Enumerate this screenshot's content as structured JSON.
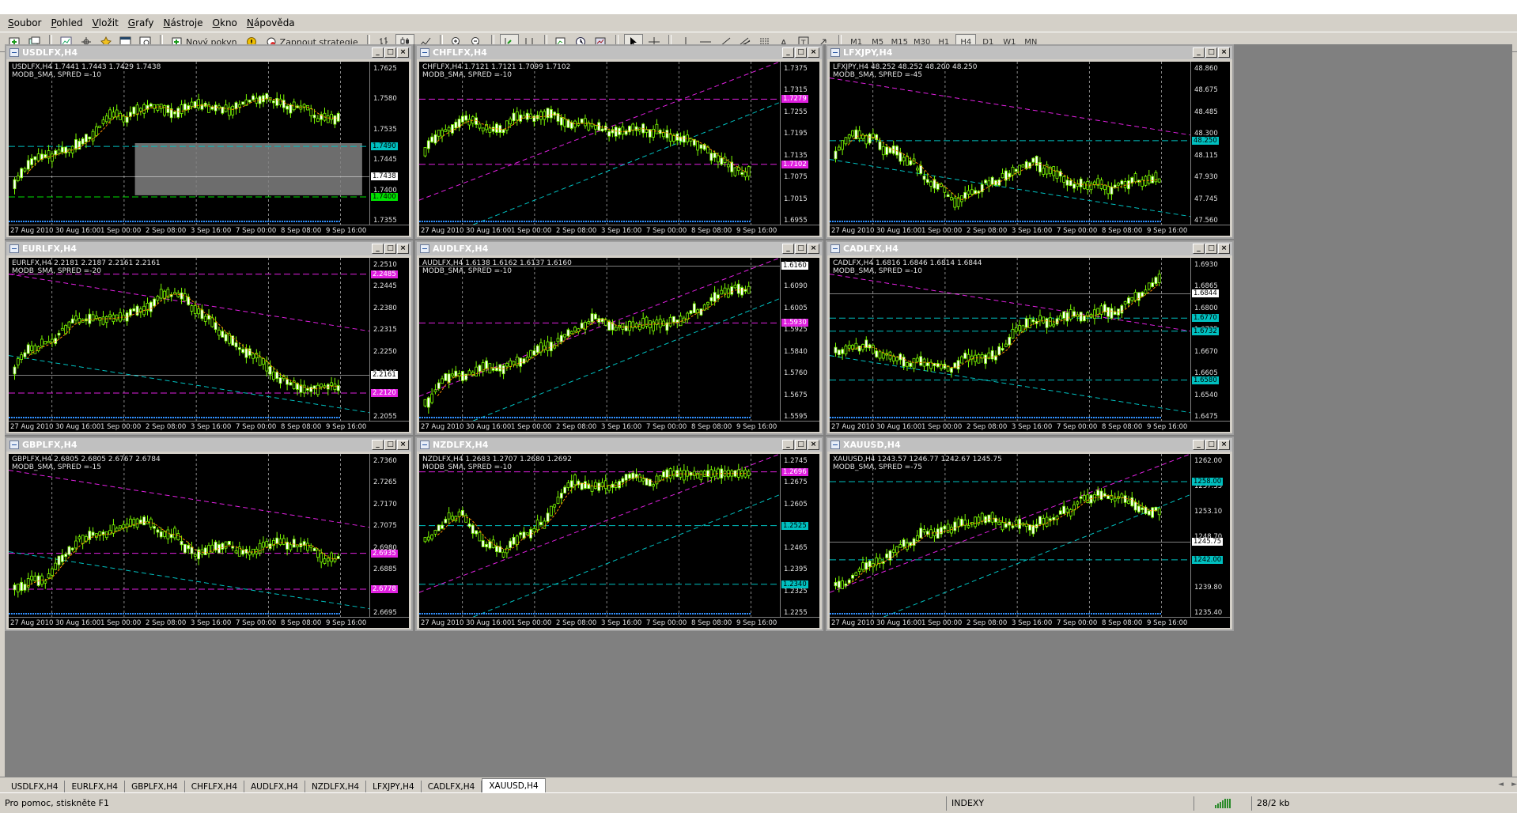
{
  "menu": [
    "Soubor",
    "Pohled",
    "Vložit",
    "Grafy",
    "Nástroje",
    "Okno",
    "Nápověda"
  ],
  "toolbar": {
    "new_order": "Nový pokyn",
    "autotrading": "Zapnout strategie",
    "timeframes": [
      "M1",
      "M5",
      "M15",
      "M30",
      "H1",
      "H4",
      "D1",
      "W1",
      "MN"
    ],
    "active_timeframe": "H4"
  },
  "time_labels": [
    "27 Aug 2010",
    "30 Aug 16:00",
    "1 Sep 00:00",
    "2 Sep 08:00",
    "3 Sep 16:00",
    "7 Sep 00:00",
    "8 Sep 08:00",
    "9 Sep 16:00"
  ],
  "charts": [
    {
      "title": "USDLFX,H4",
      "info1": "USDLFX,H4  1.7441 1.7443 1.7429 1.7438",
      "info2": "MODB_SMA, SPRED =-10",
      "ticks": [
        "1.7625",
        "1.7580",
        "1.7535",
        "1.7445",
        "1.7400",
        "1.7355"
      ],
      "markers": [
        {
          "label": "1.7490",
          "color": "#00c0c0",
          "y": 0.52
        },
        {
          "label": "1.7438",
          "color": "#ffffff",
          "y": 0.705
        },
        {
          "label": "1.7400",
          "color": "#00e000",
          "y": 0.83
        }
      ]
    },
    {
      "title": "CHFLFX,H4",
      "info1": "CHFLFX,H4  1.7121 1.7121 1.7099 1.7102",
      "info2": "MODB_SMA, SPRED =-10",
      "ticks": [
        "1.7375",
        "1.7315",
        "1.7255",
        "1.7195",
        "1.7135",
        "1.7075",
        "1.7015",
        "1.6955"
      ],
      "markers": [
        {
          "label": "1.7279",
          "color": "#e020e0",
          "y": 0.23
        },
        {
          "label": "1.7102",
          "color": "#e020e0",
          "y": 0.63
        }
      ]
    },
    {
      "title": "LFXJPY,H4",
      "info1": "LFXJPY,H4  48.252 48.252 48.200 48.250",
      "info2": "MODB_SMA, SPRED =-45",
      "ticks": [
        "48.860",
        "48.675",
        "48.485",
        "48.300",
        "48.115",
        "47.930",
        "47.745",
        "47.560"
      ],
      "markers": [
        {
          "label": "48.250",
          "color": "#00c0c0",
          "y": 0.485
        }
      ]
    },
    {
      "title": "EURLFX,H4",
      "info1": "EURLFX,H4  2.2181 2.2187 2.2161 2.2161",
      "info2": "MODB_SMA, SPRED =-20",
      "ticks": [
        "2.2510",
        "2.2445",
        "2.2380",
        "2.2315",
        "2.2250",
        "2.2185",
        "2.2120",
        "2.2055"
      ],
      "markers": [
        {
          "label": "2.2485",
          "color": "#e020e0",
          "y": 0.1
        },
        {
          "label": "2.2161",
          "color": "#ffffff",
          "y": 0.72
        },
        {
          "label": "2.2120",
          "color": "#e020e0",
          "y": 0.83
        }
      ]
    },
    {
      "title": "AUDLFX,H4",
      "info1": "AUDLFX,H4  1.6138 1.6162 1.6137 1.6160",
      "info2": "MODB_SMA, SPRED =-10",
      "ticks": [
        "1.6160",
        "1.6090",
        "1.6005",
        "1.5925",
        "1.5840",
        "1.5760",
        "1.5675",
        "1.5595"
      ],
      "markers": [
        {
          "label": "1.6160",
          "color": "#ffffff",
          "y": 0.05
        },
        {
          "label": "1.5930",
          "color": "#e020e0",
          "y": 0.4
        }
      ]
    },
    {
      "title": "CADLFX,H4",
      "info1": "CADLFX,H4  1.6816 1.6846 1.6814 1.6844",
      "info2": "MODB_SMA, SPRED =-10",
      "ticks": [
        "1.6930",
        "1.6865",
        "1.6800",
        "1.6735",
        "1.6670",
        "1.6605",
        "1.6540",
        "1.6475"
      ],
      "markers": [
        {
          "label": "1.6844",
          "color": "#ffffff",
          "y": 0.22
        },
        {
          "label": "1.6770",
          "color": "#00c0c0",
          "y": 0.37
        },
        {
          "label": "1.6732",
          "color": "#00c0c0",
          "y": 0.45
        },
        {
          "label": "1.6580",
          "color": "#00c0c0",
          "y": 0.75
        }
      ]
    },
    {
      "title": "GBPLFX,H4",
      "info1": "GBPLFX,H4  2.6805 2.6805 2.6767 2.6784",
      "info2": "MODB_SMA, SPRED =-15",
      "ticks": [
        "2.7360",
        "2.7265",
        "2.7170",
        "2.7075",
        "2.6980",
        "2.6885",
        "2.6790",
        "2.6695"
      ],
      "markers": [
        {
          "label": "2.6935",
          "color": "#e020e0",
          "y": 0.61
        },
        {
          "label": "2.6778",
          "color": "#e020e0",
          "y": 0.83
        }
      ]
    },
    {
      "title": "NZDLFX,H4",
      "info1": "NZDLFX,H4  1.2683 1.2707 1.2680 1.2692",
      "info2": "MODB_SMA, SPRED =-10",
      "ticks": [
        "1.2745",
        "1.2675",
        "1.2605",
        "1.2535",
        "1.2465",
        "1.2395",
        "1.2325",
        "1.2255"
      ],
      "markers": [
        {
          "label": "1.2696",
          "color": "#e020e0",
          "y": 0.11
        },
        {
          "label": "1.2525",
          "color": "#00c0c0",
          "y": 0.44
        },
        {
          "label": "1.2340",
          "color": "#00c0c0",
          "y": 0.8
        }
      ]
    },
    {
      "title": "XAUUSD,H4",
      "info1": "XAUUSD,H4  1243.57 1246.77 1242.67 1245.75",
      "info2": "MODB_SMA, SPRED =-75",
      "ticks": [
        "1262.00",
        "1257.55",
        "1253.10",
        "1248.70",
        "1244.30",
        "1239.80",
        "1235.40"
      ],
      "markers": [
        {
          "label": "1258.00",
          "color": "#00c0c0",
          "y": 0.17
        },
        {
          "label": "1245.75",
          "color": "#ffffff",
          "y": 0.54
        },
        {
          "label": "1242.00",
          "color": "#00c0c0",
          "y": 0.65
        }
      ]
    }
  ],
  "tabs": [
    "USDLFX,H4",
    "EURLFX,H4",
    "GBPLFX,H4",
    "CHFLFX,H4",
    "AUDLFX,H4",
    "NZDLFX,H4",
    "LFXJPY,H4",
    "CADLFX,H4",
    "XAUUSD,H4"
  ],
  "active_tab": "XAUUSD,H4",
  "status": {
    "help": "Pro pomoc, stiskněte F1",
    "profile": "INDEXY",
    "traffic": "28/2 kb"
  }
}
